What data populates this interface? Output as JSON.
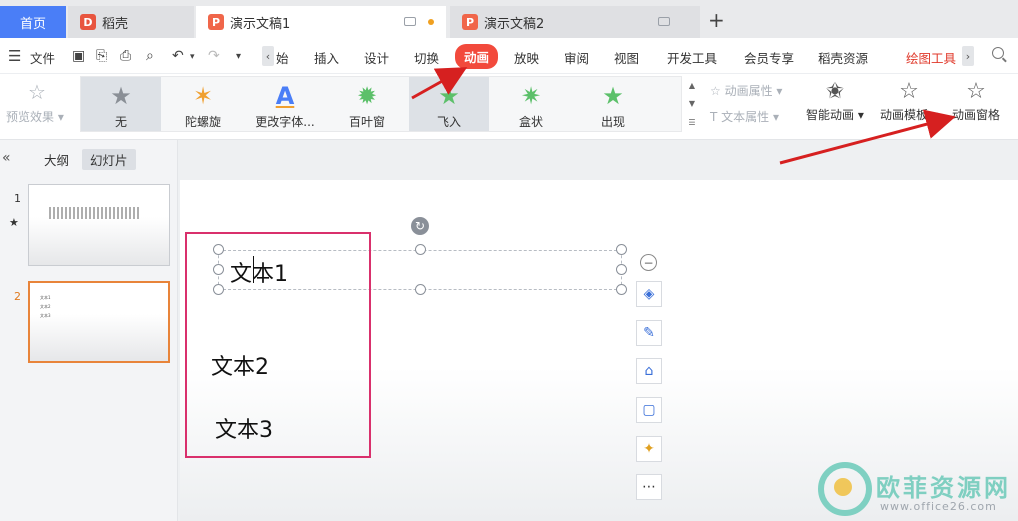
{
  "tabs": {
    "home": "首页",
    "daoke": "稻壳",
    "doc1": "演示文稿1",
    "doc2": "演示文稿2",
    "new": "+"
  },
  "menu": {
    "file": "文件",
    "items": [
      "始",
      "插入",
      "设计",
      "切换",
      "动画",
      "放映",
      "审阅",
      "视图",
      "开发工具",
      "会员专享",
      "稻壳资源",
      "绘图工具"
    ],
    "active": "动画"
  },
  "ribbon": {
    "preview": "预览效果",
    "effects": [
      {
        "label": "无",
        "icon": "star-gray-icon",
        "color": "#888888"
      },
      {
        "label": "陀螺旋",
        "icon": "star-spin-icon",
        "color": "#f0a030"
      },
      {
        "label": "更改字体...",
        "icon": "font-a-icon",
        "color": "#4a7ef7"
      },
      {
        "label": "百叶窗",
        "icon": "star-blinds-icon",
        "color": "#5cc06a"
      },
      {
        "label": "飞入",
        "icon": "star-fly-icon",
        "color": "#5cc06a"
      },
      {
        "label": "盒状",
        "icon": "star-box-icon",
        "color": "#5cc06a"
      },
      {
        "label": "出现",
        "icon": "star-appear-icon",
        "color": "#5cc06a"
      }
    ],
    "anim_props": "动画属性",
    "text_props": "文本属性",
    "smart_anim": "智能动画",
    "anim_template": "动画模板",
    "anim_pane": "动画窗格"
  },
  "left_pane": {
    "outline": "大纲",
    "slides": "幻灯片",
    "slide_numbers": [
      "1",
      "2"
    ],
    "slide1_marker": "★",
    "thumb2_lines": [
      "文本1",
      "文本2",
      "文本3"
    ]
  },
  "slide": {
    "text1": "文本1",
    "text2": "文本2",
    "text3": "文本3"
  },
  "watermark": {
    "title": "欧菲资源网",
    "url": "www.office26.com"
  },
  "colors": {
    "accent": "#4a7ef7",
    "active_menu": "#f24a3c",
    "highlight_box": "#d9306c",
    "arrow": "#d62020"
  }
}
